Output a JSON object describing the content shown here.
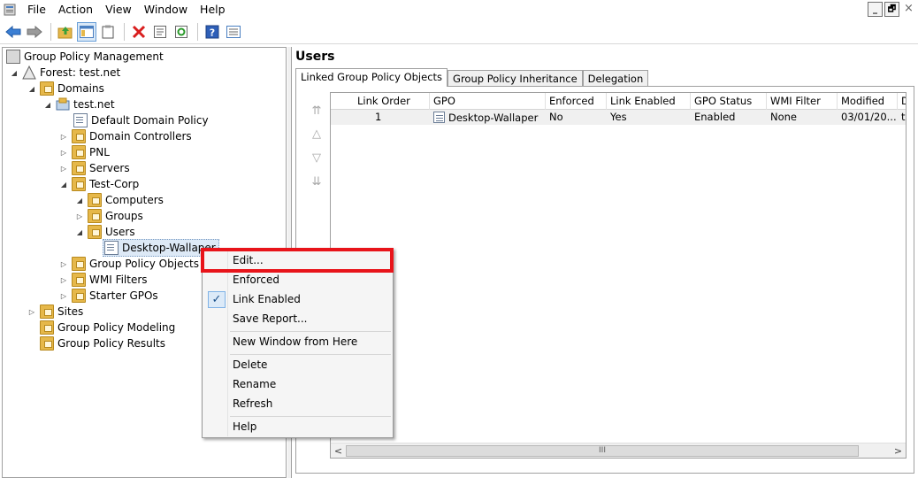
{
  "menubar": {
    "items": [
      "File",
      "Action",
      "View",
      "Window",
      "Help"
    ],
    "window_controls": {
      "minimize": "_",
      "restore": "🗗",
      "close": "×"
    }
  },
  "toolbar": {
    "icons": [
      "back-arrow-icon",
      "forward-arrow-icon",
      "up-folder-icon",
      "show-hide-tree-icon",
      "clipboard-icon",
      "delete-icon",
      "properties-icon",
      "refresh-icon",
      "help-icon",
      "details-view-icon"
    ]
  },
  "tree": {
    "root": "Group Policy Management",
    "forest": "Forest: test.net",
    "domains": "Domains",
    "domain": "test.net",
    "default_policy": "Default Domain Policy",
    "domain_controllers": "Domain Controllers",
    "pnl": "PNL",
    "servers": "Servers",
    "test_corp": "Test-Corp",
    "computers": "Computers",
    "groups": "Groups",
    "users": "Users",
    "desktop_wallaper": "Desktop-Wallaper",
    "gpo": "Group Policy Objects",
    "wmi": "WMI Filters",
    "starter": "Starter GPOs",
    "sites": "Sites",
    "modeling": "Group Policy Modeling",
    "results": "Group Policy Results"
  },
  "right": {
    "title": "Users",
    "tabs": [
      "Linked Group Policy Objects",
      "Group Policy Inheritance",
      "Delegation"
    ],
    "columns": [
      "Link Order",
      "GPO",
      "Enforced",
      "Link Enabled",
      "GPO Status",
      "WMI Filter",
      "Modified",
      "D"
    ],
    "rows": [
      {
        "link_order": "1",
        "gpo": "Desktop-Wallaper",
        "enforced": "No",
        "link_enabled": "Yes",
        "gpo_status": "Enabled",
        "wmi_filter": "None",
        "modified": "03/01/20...",
        "extra": "t"
      }
    ],
    "scroll_thumb": "III"
  },
  "context_menu": {
    "items": [
      "Edit...",
      "Enforced",
      "Link Enabled",
      "Save Report...",
      "New Window from Here",
      "Delete",
      "Rename",
      "Refresh",
      "Help"
    ],
    "checked": "Link Enabled",
    "highlight_color": "#e8141a"
  }
}
